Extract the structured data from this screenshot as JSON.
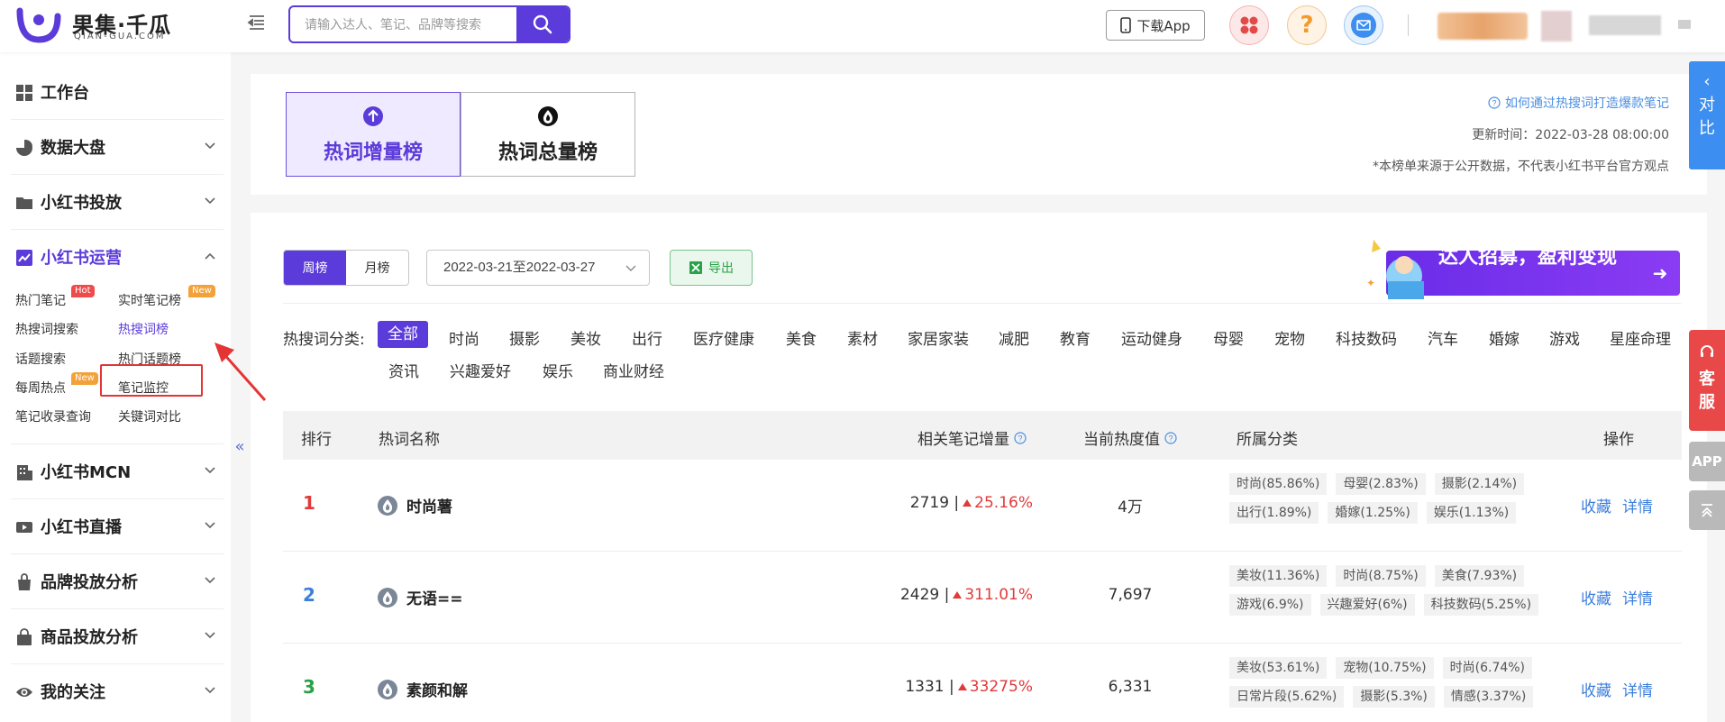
{
  "brand": {
    "name_cn": "果集·千瓜",
    "name_en": "QIAN-GUA.COM",
    "accent": "#5b3bd9"
  },
  "header": {
    "search_placeholder": "请输入达人、笔记、品牌等搜索",
    "download_label": "下载App"
  },
  "sidebar": {
    "workspace": "工作台",
    "sections": [
      "数据大盘",
      "小红书投放",
      "小红书运营",
      "小红书MCN",
      "小红书直播",
      "品牌投放分析",
      "商品投放分析",
      "我的关注"
    ],
    "sub_items": [
      "热门笔记",
      "实时笔记榜",
      "热搜词搜索",
      "热搜词榜",
      "话题搜索",
      "热门话题榜",
      "每周热点",
      "笔记监控",
      "笔记收录查询",
      "关键词对比"
    ],
    "badges": {
      "hot": "Hot",
      "new": "New"
    },
    "collapse": "«"
  },
  "tabs": [
    {
      "label": "热词增量榜"
    },
    {
      "label": "热词总量榜"
    }
  ],
  "info": {
    "how_link": "如何通过热搜词打造爆款笔记",
    "update_time": "更新时间：2022-03-28 08:00:00",
    "disclaimer": "*本榜单来源于公开数据，不代表小红书平台官方观点"
  },
  "compare": "对比",
  "filters": {
    "week": "周榜",
    "month": "月榜",
    "date_range": "2022-03-21至2022-03-27",
    "export": "导出"
  },
  "banner_text": "达人招募，盈利变现",
  "categories": {
    "label": "热搜词分类:",
    "items": [
      "全部",
      "时尚",
      "摄影",
      "美妆",
      "出行",
      "医疗健康",
      "美食",
      "素材",
      "家居家装",
      "减肥",
      "教育",
      "运动健身",
      "母婴",
      "宠物",
      "科技数码",
      "汽车",
      "婚嫁",
      "游戏",
      "星座命理",
      "资讯",
      "兴趣爱好",
      "娱乐",
      "商业财经"
    ]
  },
  "table": {
    "headers": [
      "排行",
      "热词名称",
      "相关笔记增量",
      "当前热度值",
      "所属分类",
      "操作"
    ],
    "rows": [
      {
        "rank": "1",
        "keyword": "时尚薯",
        "count": "2719 |",
        "pct": "25.16%",
        "heat": "4万",
        "tags": [
          "时尚(85.86%)",
          "母婴(2.83%)",
          "摄影(2.14%)",
          "出行(1.89%)",
          "婚嫁(1.25%)",
          "娱乐(1.13%)"
        ]
      },
      {
        "rank": "2",
        "keyword": "无语==",
        "count": "2429 |",
        "pct": "311.01%",
        "heat": "7,697",
        "tags": [
          "美妆(11.36%)",
          "时尚(8.75%)",
          "美食(7.93%)",
          "游戏(6.9%)",
          "兴趣爱好(6%)",
          "科技数码(5.25%)"
        ]
      },
      {
        "rank": "3",
        "keyword": "素颜和解",
        "count": "1331 |",
        "pct": "33275%",
        "heat": "6,331",
        "tags": [
          "美妆(53.61%)",
          "宠物(10.75%)",
          "时尚(6.74%)",
          "日常片段(5.62%)",
          "摄影(5.3%)",
          "情感(3.37%)"
        ]
      }
    ],
    "ops": {
      "fav": "收藏",
      "detail": "详情"
    }
  },
  "floating": {
    "kefu": "客服",
    "app": "APP"
  },
  "colors": {
    "rank1": "#e03a3a",
    "rank2": "#3d7fdc",
    "rank3": "#2aa149",
    "up": "#e03a3a",
    "link": "#3d7fdc"
  }
}
